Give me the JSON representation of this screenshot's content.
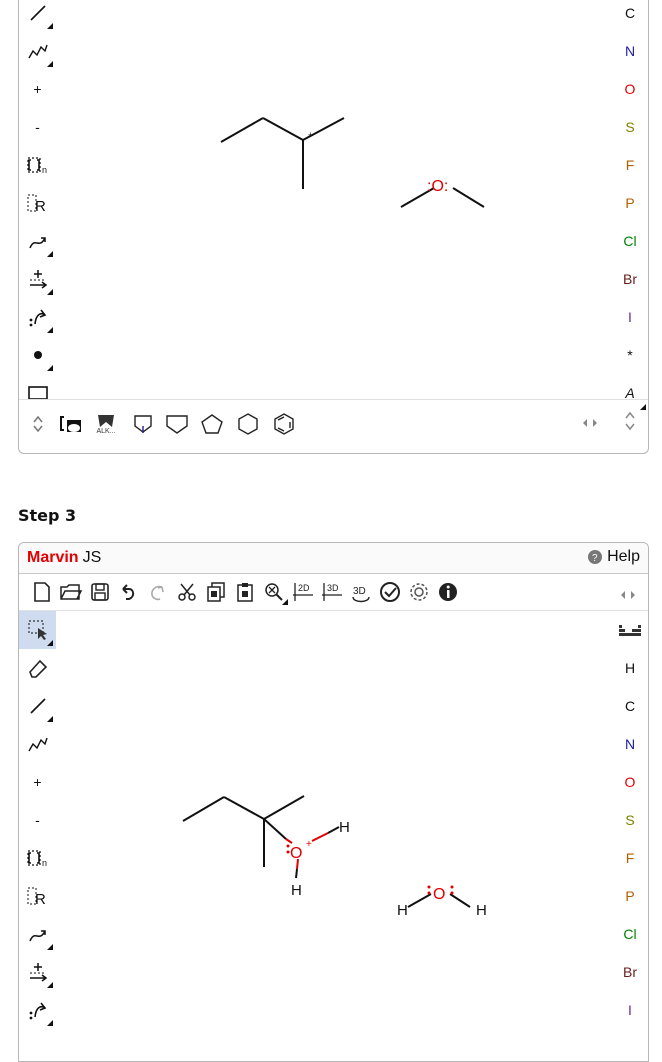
{
  "panel1": {
    "atoms": [
      "C",
      "N",
      "O",
      "S",
      "F",
      "P",
      "Cl",
      "Br",
      "I",
      "*",
      "A"
    ],
    "atom_colors": [
      "#111111",
      "#2020a0",
      "#e00000",
      "#808000",
      "#b06000",
      "#b06000",
      "#008000",
      "#6b1c1c",
      "#6a2c91",
      "#111111",
      "#111111"
    ],
    "tools": [
      "bond-icon",
      "chain-icon",
      "charge-plus-icon",
      "charge-minus-icon",
      "sgroup-bracket-icon",
      "rgroup-icon",
      "reaction-arrow-icon",
      "reaction-plus-arrow-icon",
      "electron-flow-icon",
      "radical-dot-icon",
      "rectangle-shape-icon"
    ],
    "plus_label": "+",
    "minus_label": "-",
    "r_label": "R",
    "n_label": "n",
    "alk_label": "ALK...",
    "molecule_label": ":O:"
  },
  "step_title": "Step 3",
  "panel2": {
    "brand": "Marvin",
    "brand_suffix": "JS",
    "help_label": "Help",
    "toolbar_icons": [
      "new-document-icon",
      "open-folder-icon",
      "save-icon",
      "undo-icon",
      "redo-icon",
      "cut-icon",
      "copy-icon",
      "paste-icon",
      "zoom-icon",
      "clean-2d-icon",
      "clean-3d-icon",
      "3d-view-icon",
      "check-icon",
      "settings-icon",
      "info-icon"
    ],
    "clean2d_label": "2D",
    "clean3d_label": "3D",
    "view3d_label": "3D",
    "atoms": [
      "H",
      "C",
      "N",
      "O",
      "S",
      "F",
      "P",
      "Cl",
      "Br",
      "I"
    ],
    "atom_colors": [
      "#111111",
      "#111111",
      "#2020a0",
      "#e00000",
      "#808000",
      "#b06000",
      "#b06000",
      "#008000",
      "#6b1c1c",
      "#6a2c91"
    ],
    "tools": [
      "selection-icon",
      "eraser-icon",
      "bond-icon",
      "chain-icon",
      "charge-plus-icon",
      "charge-minus-icon",
      "sgroup-bracket-icon",
      "rgroup-icon",
      "reaction-arrow-icon",
      "reaction-plus-arrow-icon",
      "electron-flow-icon"
    ],
    "molecule": {
      "oxonium_label": "O",
      "oxonium_charge": "+",
      "h_label": "H",
      "water_label": "O"
    }
  }
}
